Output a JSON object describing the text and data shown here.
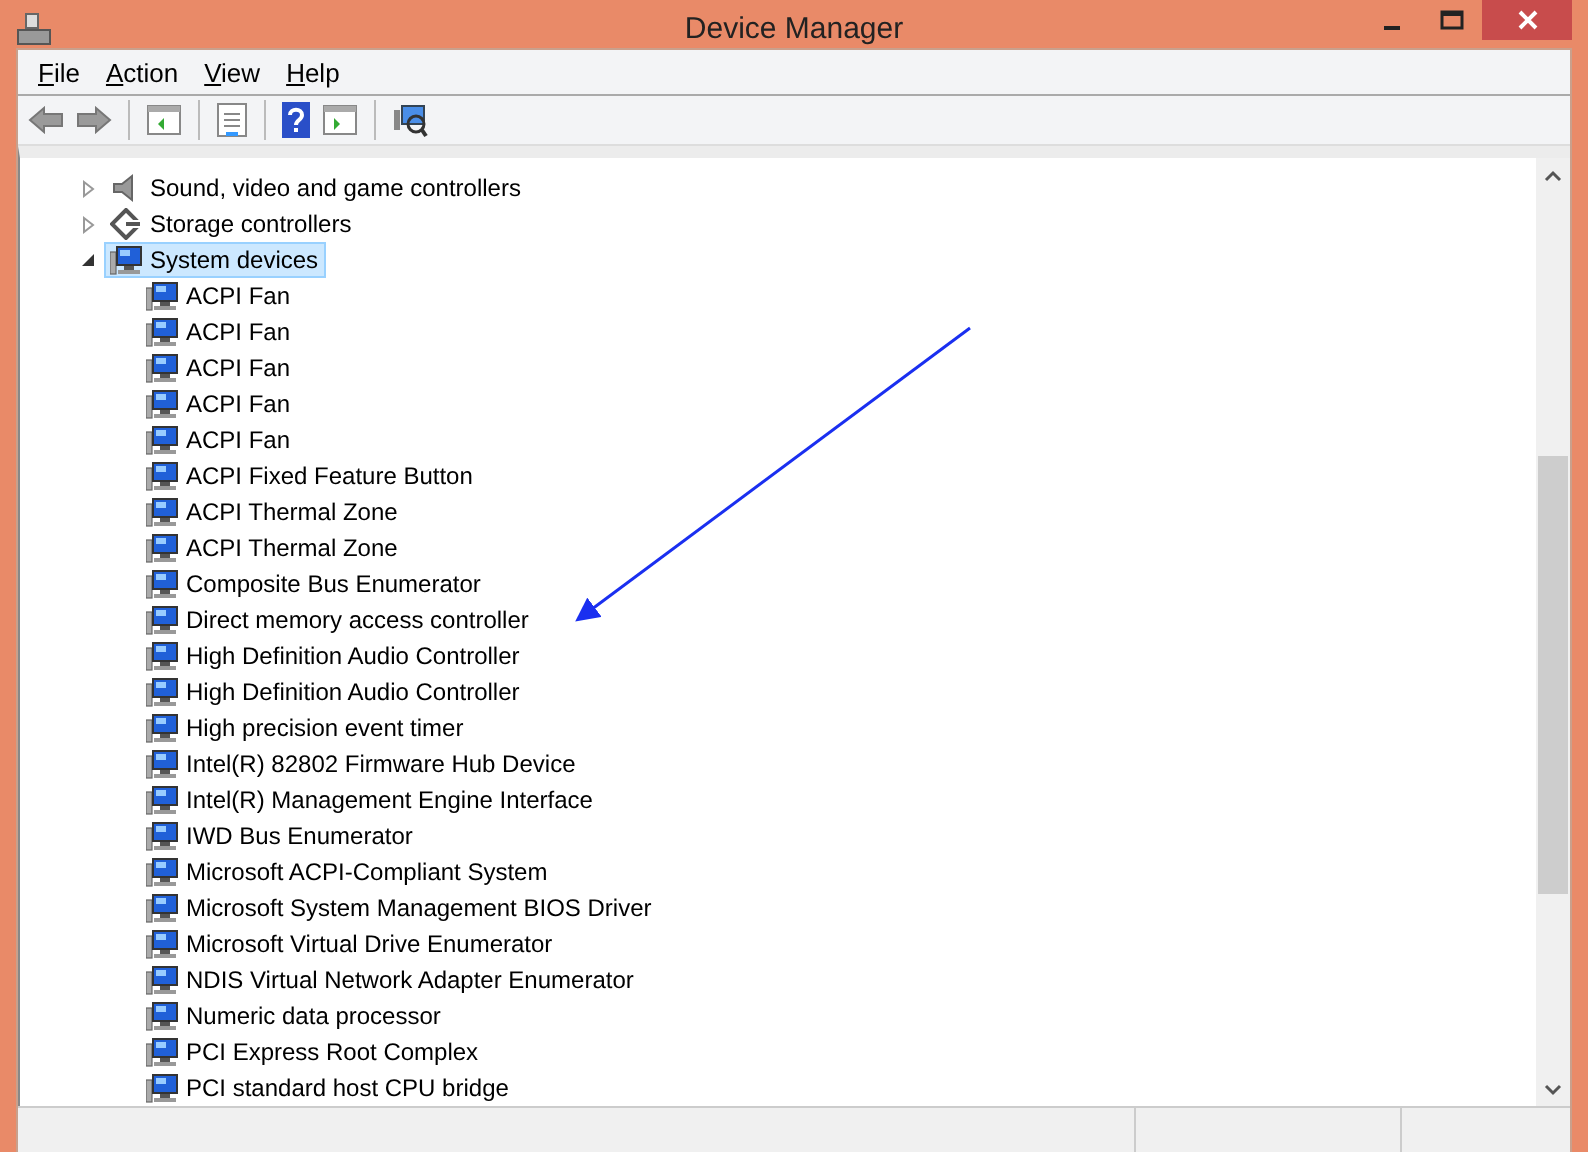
{
  "window": {
    "title": "Device Manager"
  },
  "menu": [
    {
      "label": "File"
    },
    {
      "label": "Action"
    },
    {
      "label": "View"
    },
    {
      "label": "Help"
    }
  ],
  "tree": [
    {
      "label": "Sound, video and game controllers",
      "expanded": false,
      "selected": false
    },
    {
      "label": "Storage controllers",
      "expanded": false,
      "selected": false
    },
    {
      "label": "System devices",
      "expanded": true,
      "selected": true,
      "children": [
        {
          "label": "ACPI Fan"
        },
        {
          "label": "ACPI Fan"
        },
        {
          "label": "ACPI Fan"
        },
        {
          "label": "ACPI Fan"
        },
        {
          "label": "ACPI Fan"
        },
        {
          "label": "ACPI Fixed Feature Button"
        },
        {
          "label": "ACPI Thermal Zone"
        },
        {
          "label": "ACPI Thermal Zone"
        },
        {
          "label": "Composite Bus Enumerator"
        },
        {
          "label": "Direct memory access controller"
        },
        {
          "label": "High Definition Audio Controller"
        },
        {
          "label": "High Definition Audio Controller"
        },
        {
          "label": "High precision event timer"
        },
        {
          "label": "Intel(R) 82802 Firmware Hub Device"
        },
        {
          "label": "Intel(R) Management Engine Interface"
        },
        {
          "label": "IWD Bus Enumerator"
        },
        {
          "label": "Microsoft ACPI-Compliant System"
        },
        {
          "label": "Microsoft System Management BIOS Driver"
        },
        {
          "label": "Microsoft Virtual Drive Enumerator"
        },
        {
          "label": "NDIS Virtual Network Adapter Enumerator"
        },
        {
          "label": "Numeric data processor"
        },
        {
          "label": "PCI Express Root Complex"
        },
        {
          "label": "PCI standard host CPU bridge"
        }
      ]
    }
  ]
}
